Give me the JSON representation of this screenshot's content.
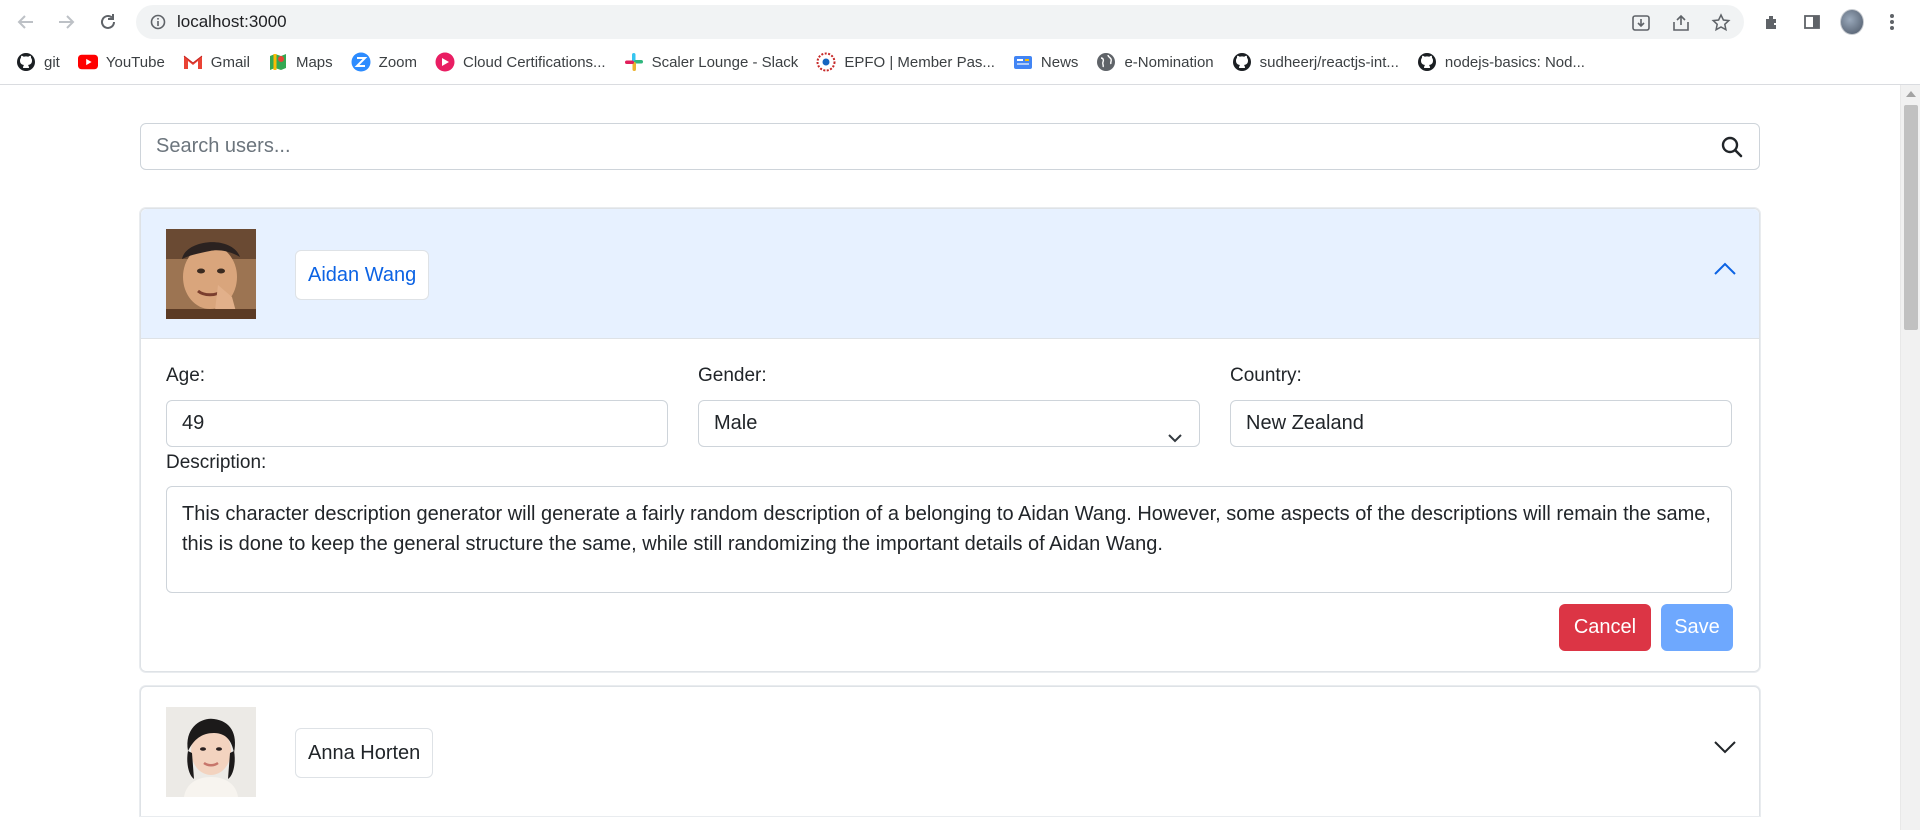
{
  "browser": {
    "url": "localhost:3000",
    "bookmarks": [
      {
        "label": "git",
        "icon": "github-icon"
      },
      {
        "label": "YouTube",
        "icon": "youtube-icon"
      },
      {
        "label": "Gmail",
        "icon": "gmail-icon"
      },
      {
        "label": "Maps",
        "icon": "maps-icon"
      },
      {
        "label": "Zoom",
        "icon": "zoom-icon"
      },
      {
        "label": "Cloud Certifications...",
        "icon": "cloud-cert-icon"
      },
      {
        "label": "Scaler Lounge - Slack",
        "icon": "slack-icon"
      },
      {
        "label": "EPFO | Member Pas...",
        "icon": "epfo-icon"
      },
      {
        "label": "News",
        "icon": "news-icon"
      },
      {
        "label": "e-Nomination",
        "icon": "globe-icon"
      },
      {
        "label": "sudheerj/reactjs-int...",
        "icon": "github-icon"
      },
      {
        "label": "nodejs-basics: Nod...",
        "icon": "github-icon"
      }
    ]
  },
  "search": {
    "placeholder": "Search users...",
    "value": ""
  },
  "users": [
    {
      "name": "Aidan Wang",
      "expanded": true,
      "age_label": "Age:",
      "age": "49",
      "gender_label": "Gender:",
      "gender": "Male",
      "country_label": "Country:",
      "country": "New Zealand",
      "description_label": "Description:",
      "description": "This character description generator will generate a fairly random description of a belonging to Aidan Wang. However, some aspects of the descriptions will remain the same, this is done to keep the general structure the same, while still randomizing the important details of Aidan Wang.",
      "cancel_label": "Cancel",
      "save_label": "Save"
    },
    {
      "name": "Anna Horten",
      "expanded": false
    }
  ],
  "colors": {
    "header_active_bg": "#e7f1ff",
    "accent": "#0c63e4",
    "cancel": "#dc3545",
    "save": "#6ea8fe"
  }
}
